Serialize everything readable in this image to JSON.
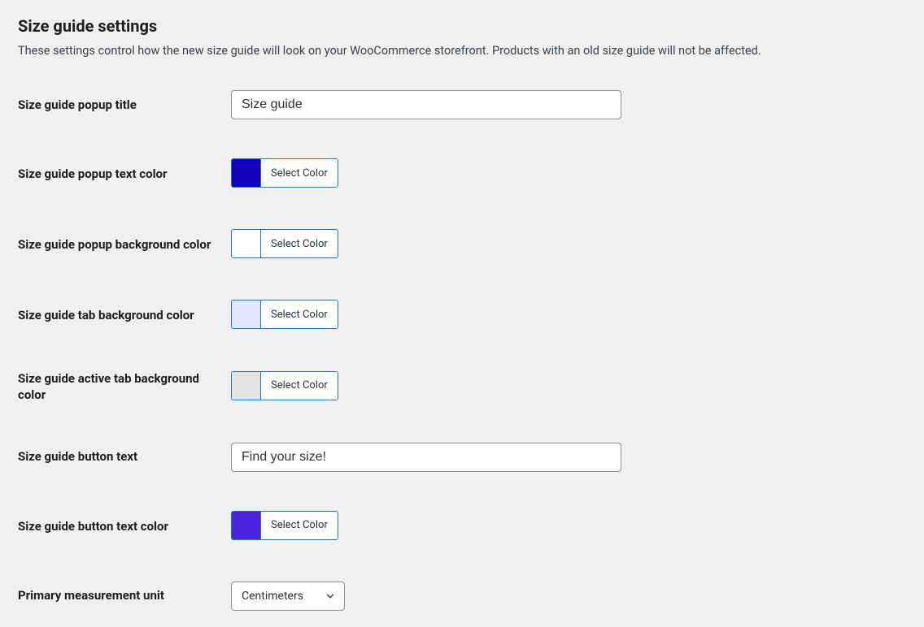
{
  "page": {
    "title": "Size guide settings",
    "description": "These settings control how the new size guide will look on your WooCommerce storefront. Products with an old size guide will not be affected."
  },
  "labels": {
    "popup_title": "Size guide popup title",
    "popup_text_color": "Size guide popup text color",
    "popup_bg_color": "Size guide popup background color",
    "tab_bg_color": "Size guide tab background color",
    "active_tab_bg_color": "Size guide active tab background color",
    "button_text": "Size guide button text",
    "button_text_color": "Size guide button text color",
    "primary_unit": "Primary measurement unit"
  },
  "values": {
    "popup_title": "Size guide",
    "button_text": "Find your size!",
    "primary_unit": "Centimeters"
  },
  "colors": {
    "popup_text": "#1300c1",
    "popup_bg": "#ffffff",
    "tab_bg": "#e3e3fb",
    "active_tab_bg": "#e5e5e5",
    "button_text": "#4a22dd"
  },
  "color_picker_label": "Select Color"
}
